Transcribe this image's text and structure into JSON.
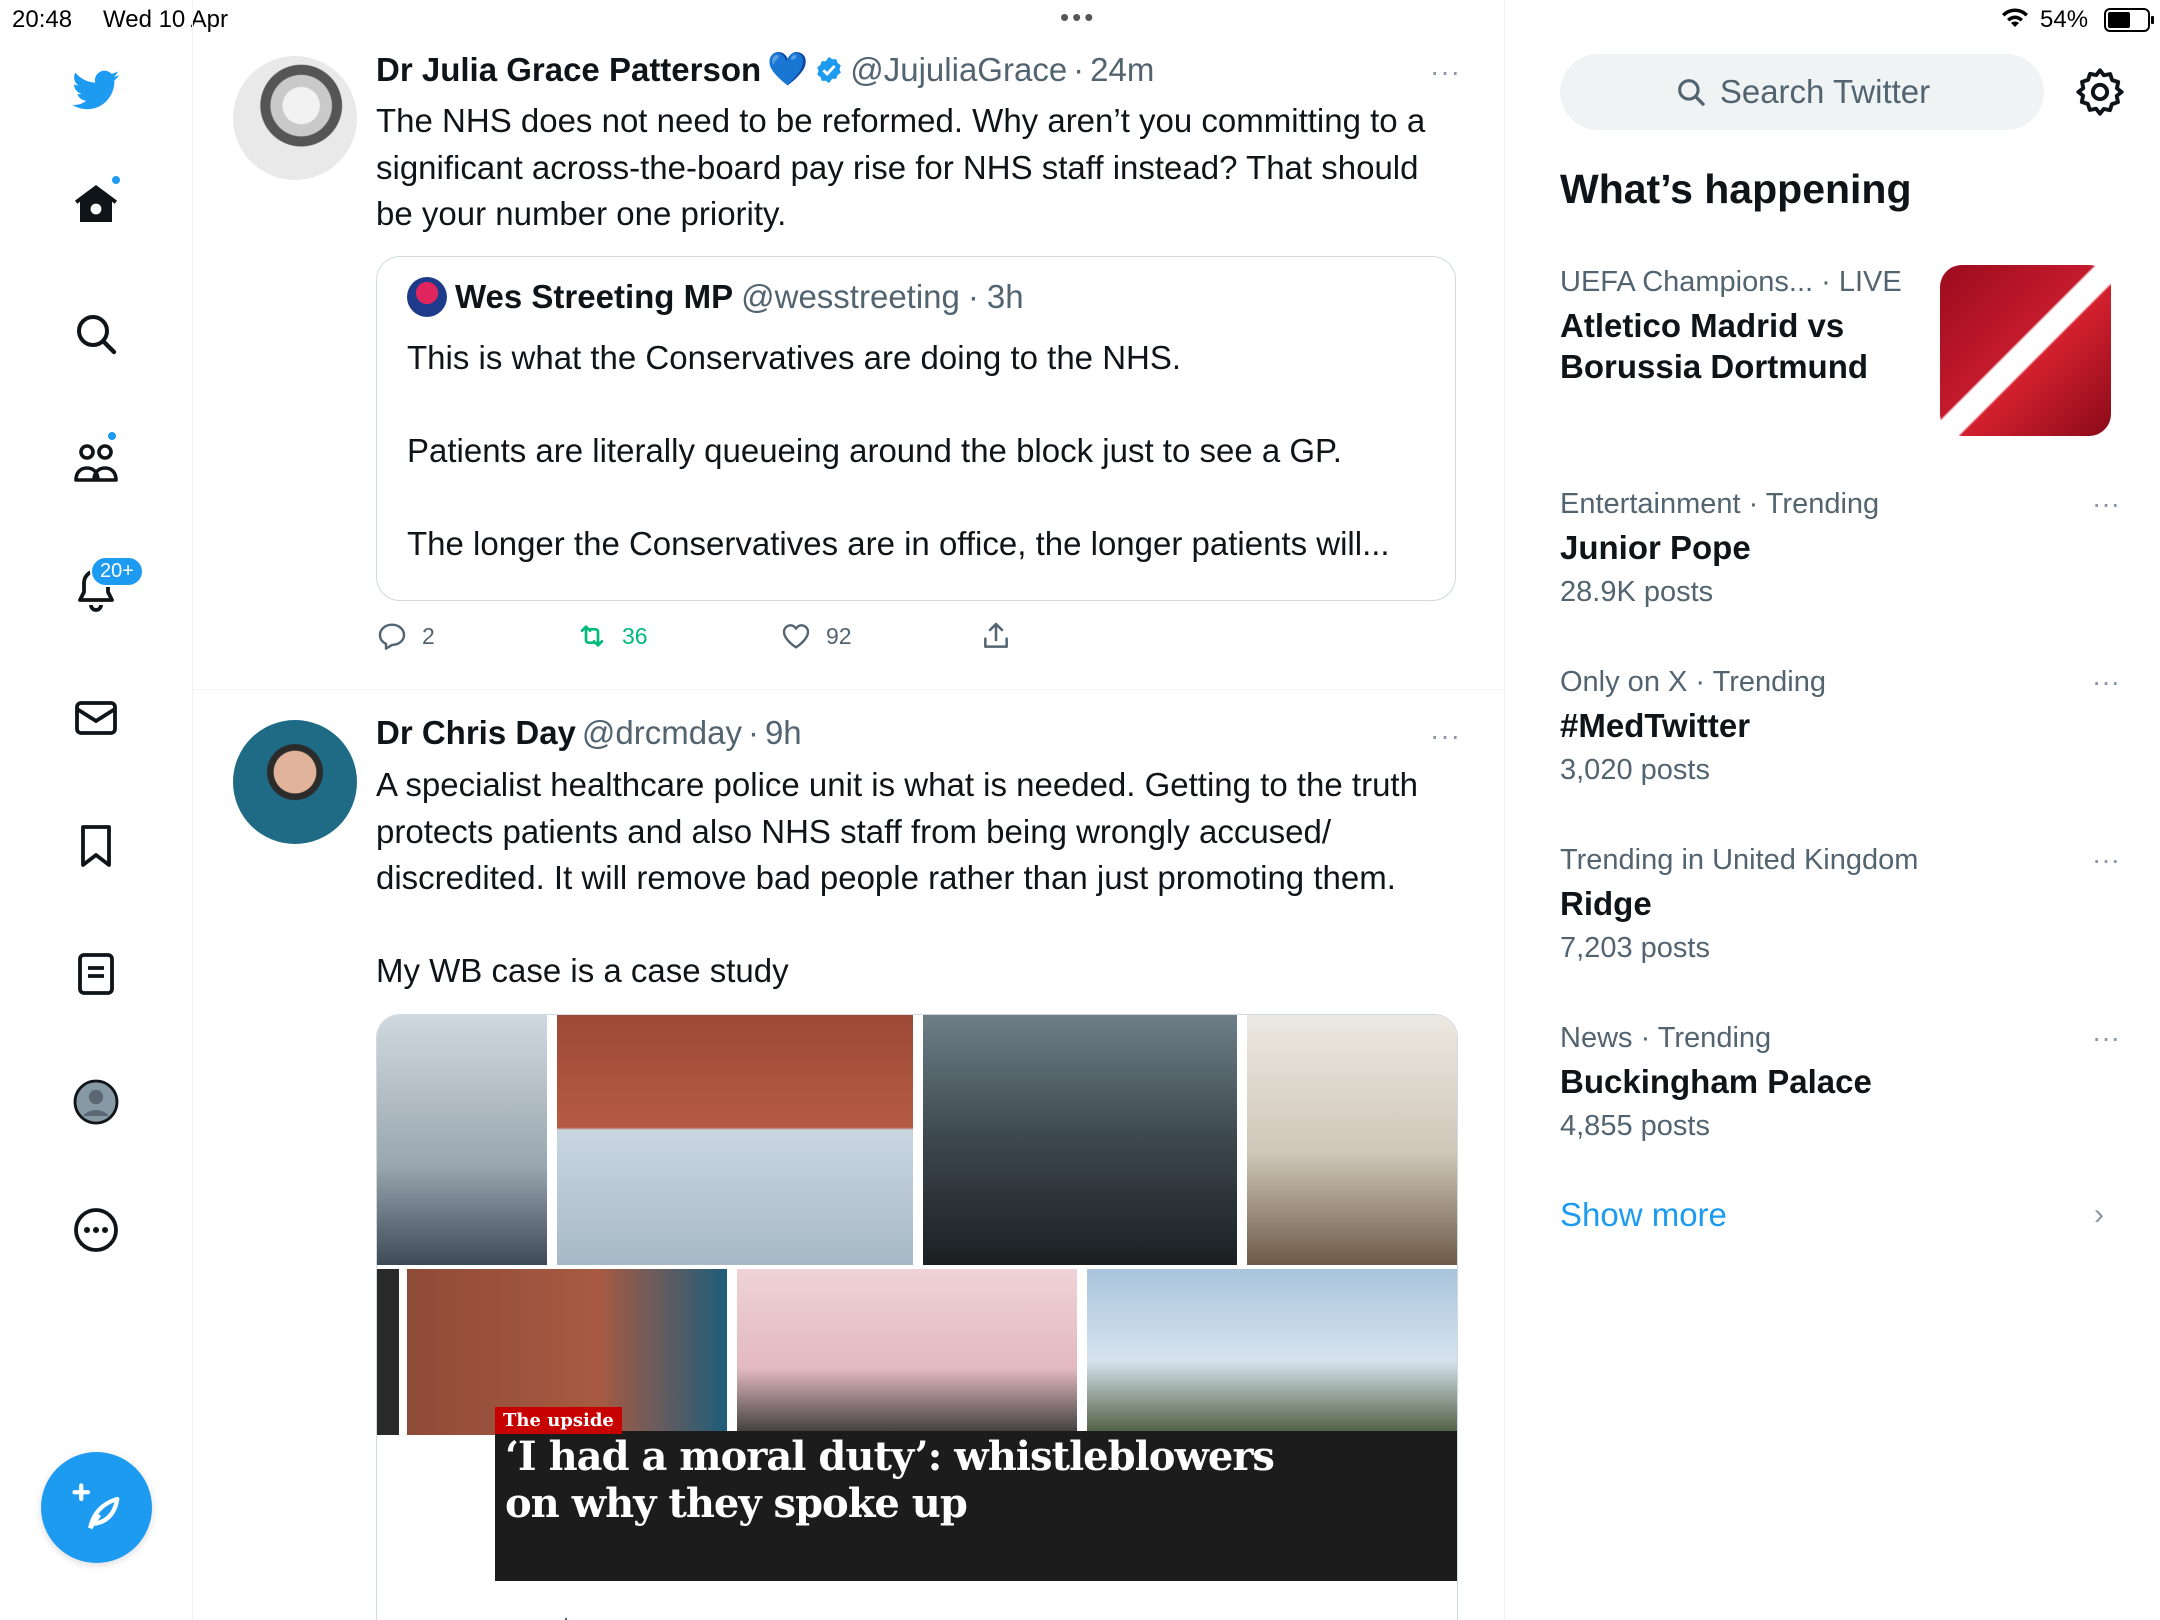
{
  "status_bar": {
    "time": "20:48",
    "date": "Wed 10 Apr",
    "battery": "54%",
    "battery_level": 0.54
  },
  "nav": {
    "notifications_badge": "20+",
    "items": [
      "twitter-logo",
      "home-icon",
      "search-icon",
      "communities-icon",
      "notifications-icon",
      "messages-icon",
      "bookmarks-icon",
      "lists-icon",
      "profile-icon",
      "more-icon"
    ]
  },
  "timeline": {
    "tweets": [
      {
        "name": "Dr Julia Grace Patterson",
        "name_emoji": "💙",
        "handle": "@JujuliaGrace",
        "sep": "·",
        "time": "24m",
        "text": "The NHS does not need to be reformed. Why aren’t you committing to a significant across-the-board pay rise for NHS staff instead? That should be your number one priority.",
        "quote": {
          "name": "Wes Streeting MP",
          "handle": "@wesstreeting",
          "sep": "·",
          "time": "3h",
          "text": "This is what the Conservatives are doing to the NHS.\n\nPatients are literally queueing around the block just to see a GP.\n\nThe longer the Conservatives are in office, the longer patients will..."
        },
        "actions": {
          "replies": "2",
          "retweets": "36",
          "likes": "92"
        }
      },
      {
        "name": "Dr Chris Day",
        "handle": "@drcmday",
        "sep": "·",
        "time": "9h",
        "text": "A specialist healthcare police unit is what is needed. Getting to the truth protects patients and also NHS staff from being wrongly accused/ discredited. It will remove bad people rather than just promoting them.\n\nMy WB case is a case study",
        "card": {
          "tag": "The upside",
          "headline": "‘I had a moral duty’: whistleblowers on why they spoke up",
          "domain": "cygnusreports.org"
        }
      }
    ]
  },
  "sidebar": {
    "search_placeholder": "Search Twitter",
    "heading": "What’s happening",
    "trends": [
      {
        "meta": "UEFA Champions... · LIVE",
        "title": "Atletico Madrid vs Borussia Dortmund",
        "posts": ""
      },
      {
        "meta": "Entertainment · Trending",
        "title": "Junior Pope",
        "posts": "28.9K posts"
      },
      {
        "meta": "Only on X · Trending",
        "title": "#MedTwitter",
        "posts": "3,020 posts"
      },
      {
        "meta": "Trending in United Kingdom",
        "title": "Ridge",
        "posts": "7,203 posts"
      },
      {
        "meta": "News · Trending",
        "title": "Buckingham Palace",
        "posts": "4,855 posts"
      }
    ],
    "show_more": "Show more",
    "more_dots": "···"
  },
  "colors": {
    "accent": "#1d9bf0",
    "text": "#0f1419",
    "secondary": "#536471",
    "retweet": "#00ba7c",
    "border": "#eff3f4"
  }
}
